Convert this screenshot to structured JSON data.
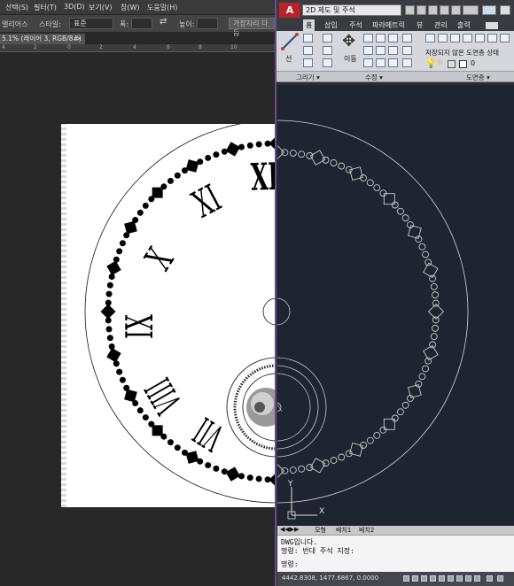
{
  "photoshop": {
    "menu": [
      "선택(S)",
      "필터(T)",
      "3D(D)",
      "보기(V)",
      "창(W)",
      "도움말(H)"
    ],
    "options": {
      "left_label": "앨리어스",
      "style_label": "스타일:",
      "style_value": "표준",
      "width_label": "폭:",
      "height_label": "높이:",
      "refine_button": "가장자리 다듬"
    },
    "doc_tab": "5.1% (레이어 3, RGB/8#)",
    "doc_tab_close": "×",
    "ruler_labels": [
      "4",
      "2",
      "0",
      "2",
      "4",
      "6",
      "8",
      "10"
    ],
    "clock_numerals": [
      "XII",
      "XI",
      "X",
      "IX",
      "VIII",
      "VII"
    ]
  },
  "autocad": {
    "logo": "A",
    "workspace": "2D 제도 및 주석",
    "tabs": [
      "홈",
      "삽입",
      "주석",
      "파라메트릭",
      "뷰",
      "관리",
      "출력"
    ],
    "ribbon": {
      "line_label": "선",
      "move_label": "이동",
      "layer_status": "저장되지 않은 도면층 상태",
      "layer_value": "0",
      "panels": [
        "그리기 ▾",
        "수정 ▾",
        "도면층 ▾"
      ]
    },
    "ucs": {
      "y_label": "Y",
      "x_label": "X"
    },
    "layout_tabs": [
      "모형",
      "배치1",
      "배치2"
    ],
    "command_lines": [
      "DWG입니다.",
      "명령: 반대 주석 지정:",
      "명령:"
    ],
    "coordinates": "4442.8308, 1477.6867, 0.0000"
  }
}
